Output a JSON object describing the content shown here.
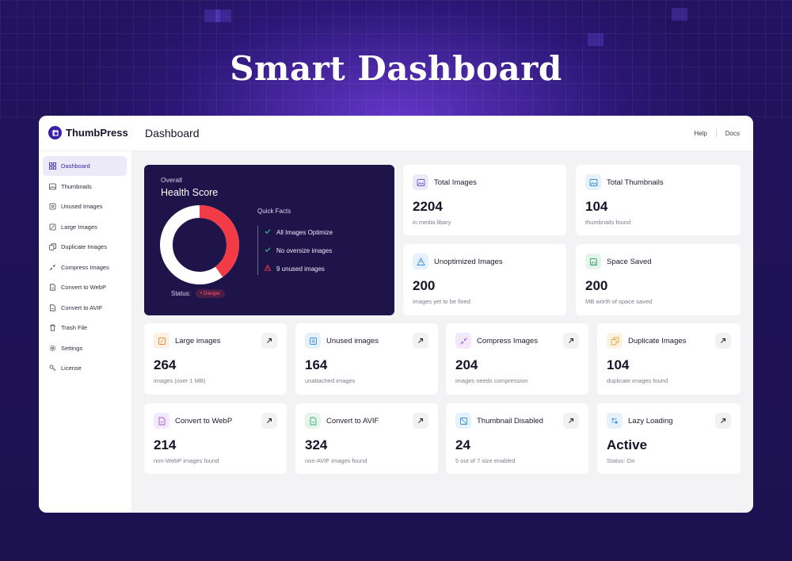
{
  "headline": "Smart Dashboard",
  "brand": {
    "name": "ThumbPress",
    "color": "#3b1fa8"
  },
  "page_title": "Dashboard",
  "top_links": [
    "Help",
    "Docs"
  ],
  "sidebar": {
    "items": [
      {
        "label": "Dashboard",
        "icon": "grid-icon",
        "active": true
      },
      {
        "label": "Thumbnails",
        "icon": "image-icon"
      },
      {
        "label": "Unused Images",
        "icon": "unused-image-icon"
      },
      {
        "label": "Large Images",
        "icon": "expand-image-icon"
      },
      {
        "label": "Duplicate Images",
        "icon": "duplicate-icon"
      },
      {
        "label": "Compress Images",
        "icon": "compress-icon"
      },
      {
        "label": "Convert to WebP",
        "icon": "file-convert-icon"
      },
      {
        "label": "Convert to AVIF",
        "icon": "file-convert-icon"
      },
      {
        "label": "Trash File",
        "icon": "trash-icon"
      },
      {
        "label": "Settings",
        "icon": "gear-icon"
      },
      {
        "label": "License",
        "icon": "key-icon"
      }
    ]
  },
  "health": {
    "overall": "Overall",
    "title": "Health Score",
    "score_label": "40%",
    "score": 0.4,
    "status_label": "Status:",
    "status_value": "Danger",
    "quick_facts_title": "Quick Facts",
    "facts": [
      {
        "text": "All Images Optimize",
        "icon": "check-icon"
      },
      {
        "text": "No oversize images",
        "icon": "check-icon"
      },
      {
        "text": "9 unused images",
        "icon": "warning-icon"
      }
    ],
    "colors": {
      "ring_fill": "#f23b47",
      "ring_track": "#ffffff",
      "card_bg": "#1e1449"
    }
  },
  "stat_cards": [
    {
      "title": "Total Images",
      "value": "2204",
      "sub": "in media libary",
      "icon": "image-icon",
      "color": "#6a5acd"
    },
    {
      "title": "Total Thumbnails",
      "value": "104",
      "sub": "thumbnails found",
      "icon": "image-icon",
      "color": "#3a8fd6"
    },
    {
      "title": "Unoptimized Images",
      "value": "200",
      "sub": "images yet to be fixed",
      "icon": "warning-icon",
      "color": "#3a8fd6"
    },
    {
      "title": "Space Saved",
      "value": "200",
      "sub": "MB worth of space saved",
      "icon": "save-icon",
      "color": "#3aa86b"
    }
  ],
  "feature_cards": [
    {
      "title": "Large images",
      "value": "264",
      "sub": "images (over 1 MB)",
      "icon": "expand-image-icon",
      "color": "#e8883a"
    },
    {
      "title": "Unused images",
      "value": "164",
      "sub": "unattached images",
      "icon": "unused-image-icon",
      "color": "#3a8fd6"
    },
    {
      "title": "Compress Images",
      "value": "204",
      "sub": "images needs compression",
      "icon": "compress-icon",
      "color": "#9a5ad6"
    },
    {
      "title": "Duplicate Images",
      "value": "104",
      "sub": "duplicate images found",
      "icon": "duplicate-icon",
      "color": "#e8a43a"
    },
    {
      "title": "Convert to WebP",
      "value": "214",
      "sub": "non-WebP images found",
      "icon": "file-convert-icon",
      "color": "#9a5ad6"
    },
    {
      "title": "Convert to AVIF",
      "value": "324",
      "sub": "non-AVIF images found",
      "icon": "file-convert-icon",
      "color": "#3aa86b"
    },
    {
      "title": "Thumbnail Disabled",
      "value": "24",
      "sub": "5 out of 7 size enabled",
      "icon": "image-off-icon",
      "color": "#3a8fd6"
    },
    {
      "title": "Lazy Loading",
      "value": "Active",
      "sub": "Status: On",
      "icon": "loader-icon",
      "color": "#3a8fd6"
    }
  ]
}
